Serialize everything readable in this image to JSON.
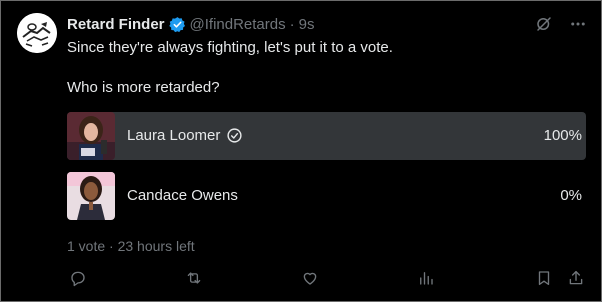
{
  "tweet": {
    "author_name": "Retard Finder",
    "handle": "@IfindRetards",
    "separator": "·",
    "time": "9s",
    "line1": "Since they're always fighting, let's put it to a vote.",
    "line2": "Who is more retarded?"
  },
  "poll": {
    "options": [
      {
        "label": "Laura Loomer",
        "percent_text": "100%",
        "percent": 100,
        "winner": true
      },
      {
        "label": "Candace Owens",
        "percent_text": "0%",
        "percent": 0,
        "winner": false
      }
    ],
    "votes": "1 vote",
    "time_left": "23 hours left"
  },
  "colors": {
    "background": "#000000",
    "text": "#e7e9ea",
    "muted": "#71767b",
    "bar": "#333639",
    "verified": "#1d9bf0"
  },
  "icons": {
    "avatar": "cartoon-avatar",
    "verified": "verified-badge-icon",
    "grok": "grok-icon",
    "more": "more-options-icon",
    "reply": "reply-icon",
    "repost": "repost-icon",
    "like": "like-icon",
    "views": "views-icon",
    "bookmark": "bookmark-icon",
    "share": "share-icon"
  }
}
